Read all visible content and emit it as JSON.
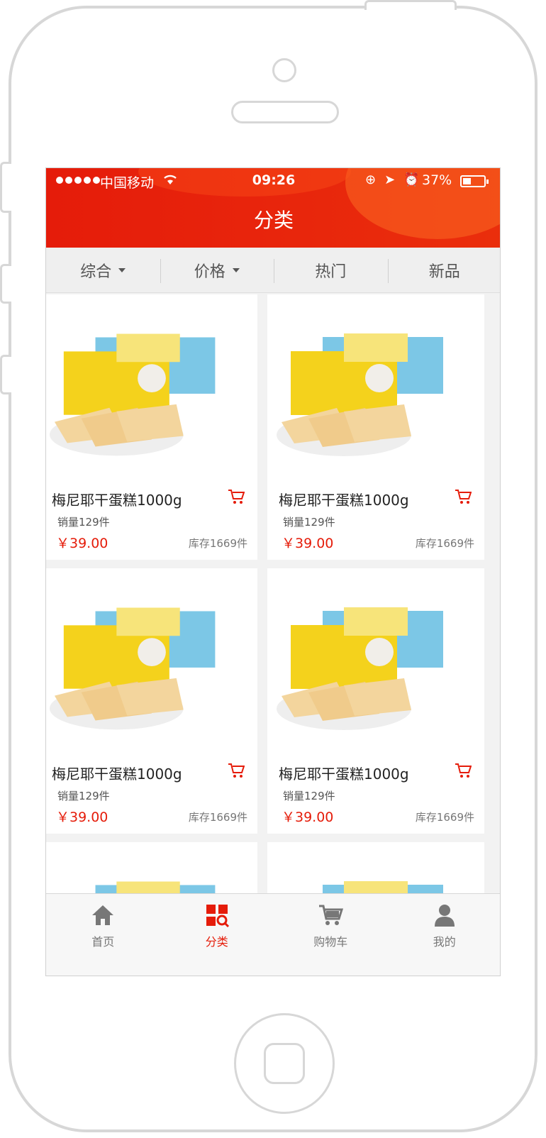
{
  "status": {
    "carrier": "中国移动",
    "time": "09:26",
    "battery": "37%"
  },
  "header": {
    "title": "分类"
  },
  "filters": [
    {
      "label": "综合",
      "has_caret": true
    },
    {
      "label": "价格",
      "has_caret": true
    },
    {
      "label": "热门",
      "has_caret": false
    },
    {
      "label": "新品",
      "has_caret": false
    }
  ],
  "products": [
    {
      "name": "梅尼耶干蛋糕1000g",
      "sold": "销量129件",
      "price": "￥39.00",
      "stock": "库存1669件"
    },
    {
      "name": "梅尼耶干蛋糕1000g",
      "sold": "销量129件",
      "price": "￥39.00",
      "stock": "库存1669件"
    },
    {
      "name": "梅尼耶干蛋糕1000g",
      "sold": "销量129件",
      "price": "￥39.00",
      "stock": "库存1669件"
    },
    {
      "name": "梅尼耶干蛋糕1000g",
      "sold": "销量129件",
      "price": "￥39.00",
      "stock": "库存1669件"
    }
  ],
  "tabs": [
    {
      "label": "首页",
      "icon": "home-icon"
    },
    {
      "label": "分类",
      "icon": "category-icon"
    },
    {
      "label": "购物车",
      "icon": "cart-icon"
    },
    {
      "label": "我的",
      "icon": "user-icon"
    }
  ],
  "colors": {
    "accent": "#e51c0a"
  }
}
